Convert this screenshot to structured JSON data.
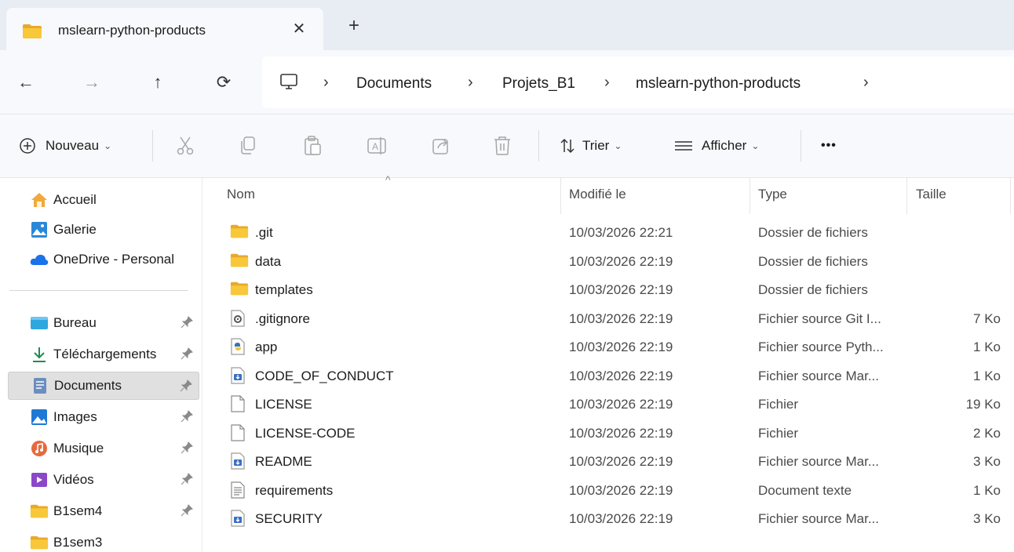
{
  "tab": {
    "title": "mslearn-python-products",
    "close_label": "✕",
    "new_label": "+"
  },
  "nav": {
    "back": "←",
    "forward": "→",
    "up": "↑",
    "refresh": "⟳",
    "breadcrumbs": [
      "Documents",
      "Projets_B1",
      "mslearn-python-products"
    ],
    "separator": "›"
  },
  "commands": {
    "new_label": "Nouveau",
    "sort_label": "Trier",
    "view_label": "Afficher",
    "more_label": "•••",
    "icons": [
      "cut-icon",
      "copy-icon",
      "paste-icon",
      "rename-icon",
      "share-icon",
      "delete-icon"
    ]
  },
  "sidebar": {
    "top": [
      {
        "label": "Accueil",
        "icon": "home-icon"
      },
      {
        "label": "Galerie",
        "icon": "gallery-icon"
      },
      {
        "label": "OneDrive - Personal",
        "icon": "onedrive-icon"
      }
    ],
    "quick": [
      {
        "label": "Bureau",
        "icon": "desktop-icon",
        "pinned": true
      },
      {
        "label": "Téléchargements",
        "icon": "download-icon",
        "pinned": true
      },
      {
        "label": "Documents",
        "icon": "documents-icon",
        "pinned": true,
        "selected": true
      },
      {
        "label": "Images",
        "icon": "images-icon",
        "pinned": true
      },
      {
        "label": "Musique",
        "icon": "music-icon",
        "pinned": true
      },
      {
        "label": "Vidéos",
        "icon": "videos-icon",
        "pinned": true
      },
      {
        "label": "B1sem4",
        "icon": "folder-icon",
        "pinned": true
      },
      {
        "label": "B1sem3",
        "icon": "folder-icon",
        "pinned": false
      }
    ]
  },
  "list": {
    "columns": {
      "name": "Nom",
      "modified": "Modifié le",
      "type": "Type",
      "size": "Taille"
    },
    "sort_indicator": "^",
    "rows": [
      {
        "name": ".git",
        "date": "10/03/2026 22:21",
        "type": "Dossier de fichiers",
        "size": "",
        "icon": "folder"
      },
      {
        "name": "data",
        "date": "10/03/2026 22:19",
        "type": "Dossier de fichiers",
        "size": "",
        "icon": "folder"
      },
      {
        "name": "templates",
        "date": "10/03/2026 22:19",
        "type": "Dossier de fichiers",
        "size": "",
        "icon": "folder"
      },
      {
        "name": ".gitignore",
        "date": "10/03/2026 22:19",
        "type": "Fichier source Git I...",
        "size": "7 Ko",
        "icon": "gear-file"
      },
      {
        "name": "app",
        "date": "10/03/2026 22:19",
        "type": "Fichier source Pyth...",
        "size": "1 Ko",
        "icon": "python-file"
      },
      {
        "name": "CODE_OF_CONDUCT",
        "date": "10/03/2026 22:19",
        "type": "Fichier source Mar...",
        "size": "1 Ko",
        "icon": "markdown-file"
      },
      {
        "name": "LICENSE",
        "date": "10/03/2026 22:19",
        "type": "Fichier",
        "size": "19 Ko",
        "icon": "blank-file"
      },
      {
        "name": "LICENSE-CODE",
        "date": "10/03/2026 22:19",
        "type": "Fichier",
        "size": "2 Ko",
        "icon": "blank-file"
      },
      {
        "name": "README",
        "date": "10/03/2026 22:19",
        "type": "Fichier source Mar...",
        "size": "3 Ko",
        "icon": "markdown-file"
      },
      {
        "name": "requirements",
        "date": "10/03/2026 22:19",
        "type": "Document texte",
        "size": "1 Ko",
        "icon": "text-file"
      },
      {
        "name": "SECURITY",
        "date": "10/03/2026 22:19",
        "type": "Fichier source Mar...",
        "size": "3 Ko",
        "icon": "markdown-file"
      }
    ]
  },
  "colors": {
    "folder": "#f8c73a",
    "folder_dark": "#e8a92a",
    "accent": "#0067c0",
    "selected_bg": "#e0e0e0"
  }
}
